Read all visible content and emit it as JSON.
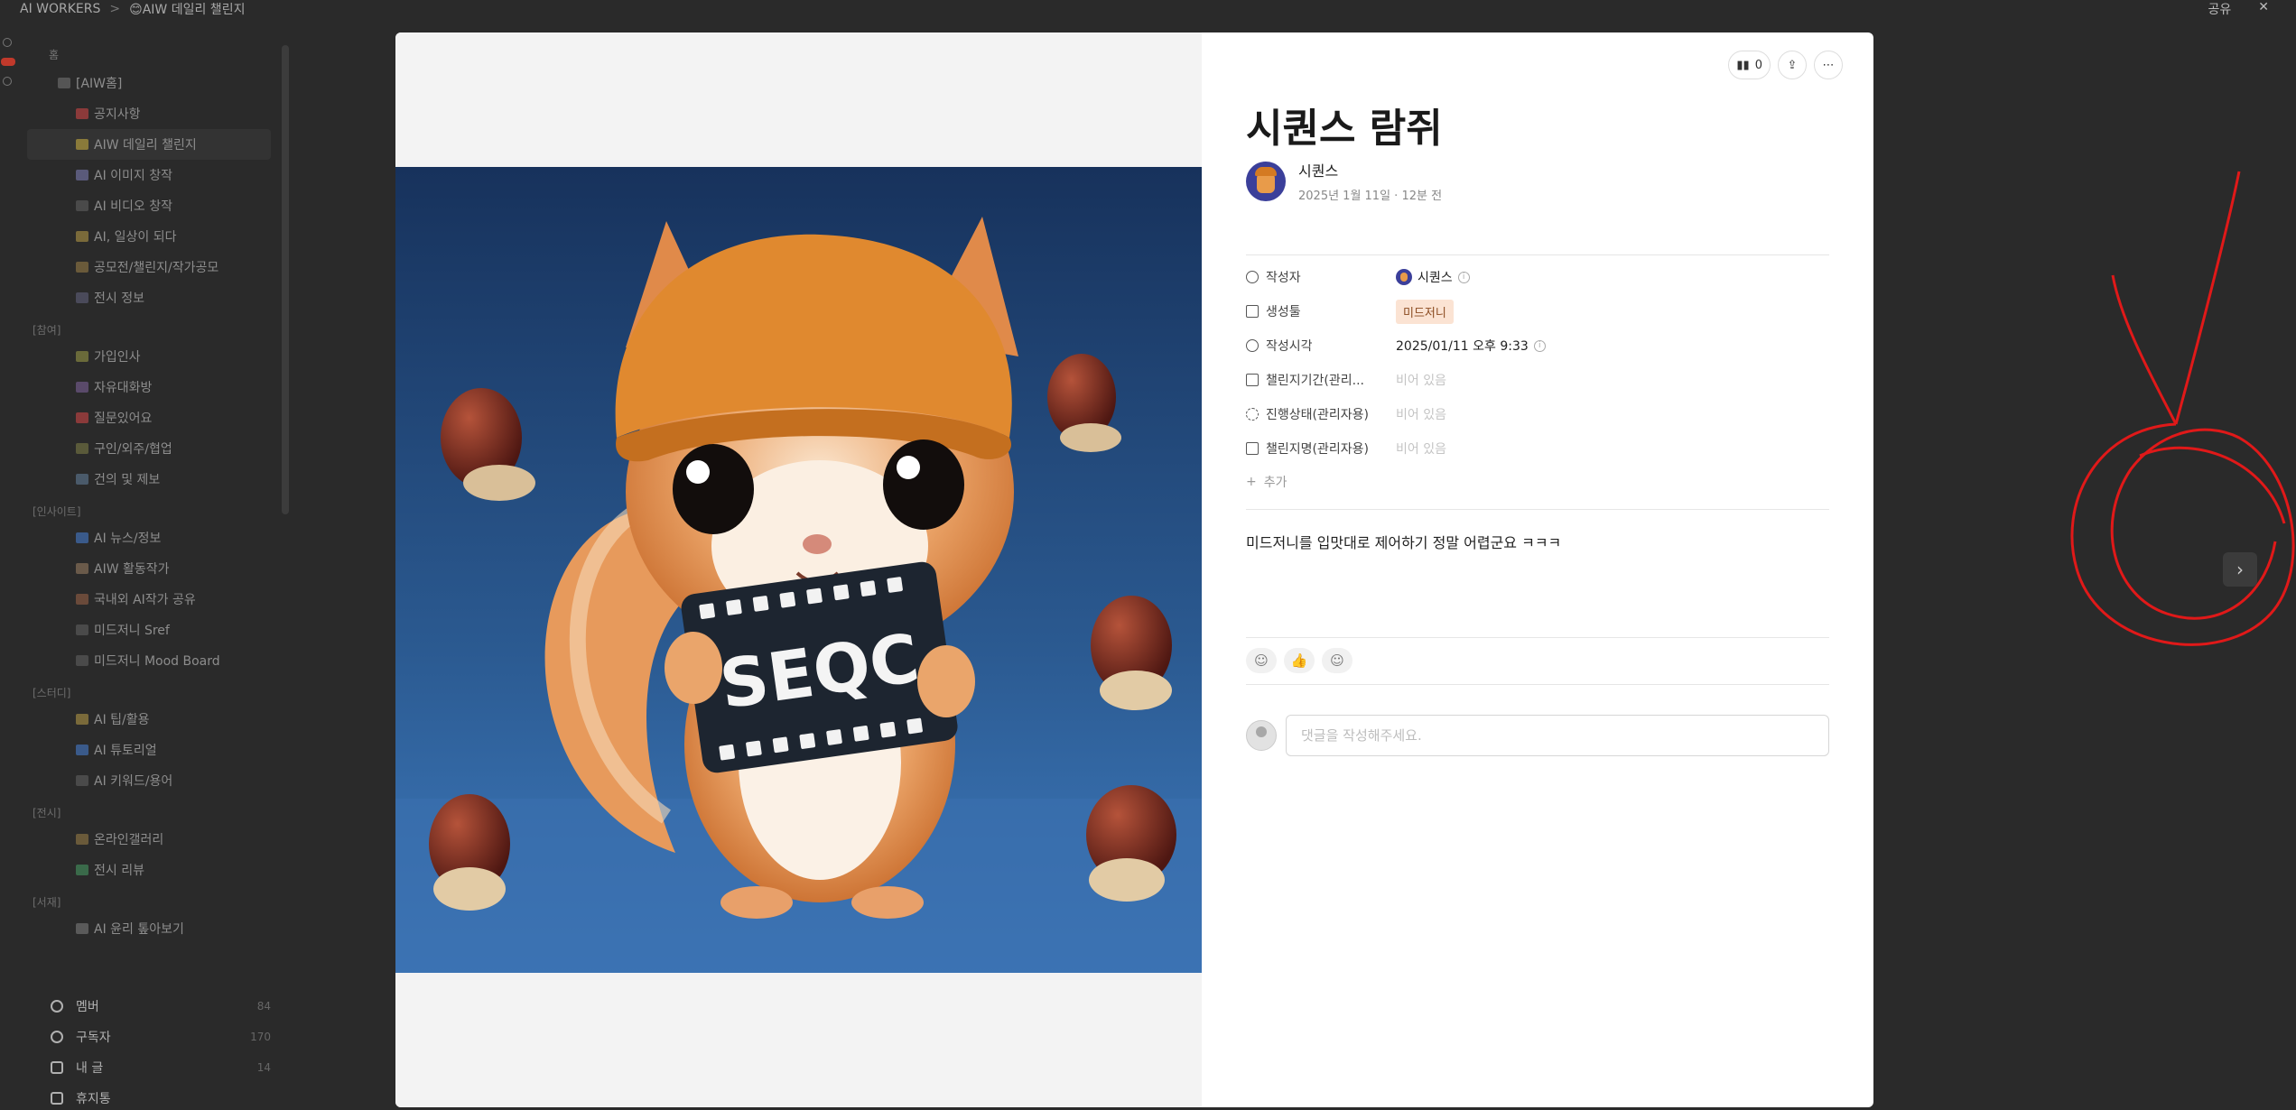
{
  "topbar": {
    "crumb_workspace": "AI WORKERS",
    "crumb_separator": ">",
    "crumb_page": "😊AIW 데일리 챌린지",
    "share_label": "공유",
    "close_glyph": "✕"
  },
  "sidebar": {
    "section_label": "홈",
    "root_label": "[AIW홈]",
    "home_items": [
      {
        "label": "공지사항"
      },
      {
        "label": "AIW 데일리 챌린지"
      },
      {
        "label": "AI 이미지 창작"
      },
      {
        "label": "AI 비디오 창작"
      },
      {
        "label": "AI, 일상이 되다"
      },
      {
        "label": "공모전/챌린지/작가공모"
      },
      {
        "label": "전시 정보"
      }
    ],
    "group1": "[참여]",
    "group1_items": [
      {
        "label": "가입인사"
      },
      {
        "label": "자유대화방"
      },
      {
        "label": "질문있어요"
      },
      {
        "label": "구인/외주/협업"
      },
      {
        "label": "건의 및 제보"
      }
    ],
    "group2": "[인사이트]",
    "group2_items": [
      {
        "label": "AI 뉴스/정보"
      },
      {
        "label": "AIW 활동작가"
      },
      {
        "label": "국내외 AI작가 공유"
      },
      {
        "label": "미드저니 Sref"
      },
      {
        "label": "미드저니 Mood Board"
      }
    ],
    "group3": "[스터디]",
    "group3_items": [
      {
        "label": "AI 팁/활용"
      },
      {
        "label": "AI 튜토리얼"
      },
      {
        "label": "AI 키워드/용어"
      }
    ],
    "group4": "[전시]",
    "group4_items": [
      {
        "label": "온라인갤러리"
      },
      {
        "label": "전시 리뷰"
      }
    ],
    "group5": "[서재]",
    "group5_items": [
      {
        "label": "AI 윤리 톺아보기"
      }
    ],
    "bottom": [
      {
        "label": "멤버",
        "count": "84"
      },
      {
        "label": "구독자",
        "count": "170"
      },
      {
        "label": "내 글",
        "count": "14"
      },
      {
        "label": "휴지통",
        "count": ""
      }
    ]
  },
  "post": {
    "views": "0",
    "title": "시퀀스 람쥐",
    "author": "시퀀스",
    "date": "2025년 1월 11일 · 12분 전",
    "image_caption": "SEQC",
    "props": [
      {
        "key": "작성자",
        "value": "시퀀스",
        "type": "user"
      },
      {
        "key": "생성툴",
        "value": "미드저니",
        "type": "tag"
      },
      {
        "key": "작성시각",
        "value": "2025/01/11 오후 9:33",
        "type": "time"
      },
      {
        "key": "챌린지기간(관리...",
        "value": "비어 있음",
        "type": "empty"
      },
      {
        "key": "진행상태(관리자용)",
        "value": "비어 있음",
        "type": "empty"
      },
      {
        "key": "챌린지명(관리자용)",
        "value": "비어 있음",
        "type": "empty"
      }
    ],
    "add_prop": "추가",
    "body": "미드저니를 입맛대로 제어하기 정말 어렵군요 ㅋㅋㅋ",
    "comment_placeholder": "댓글을 작성해주세요."
  },
  "colors": {
    "annotation": "#e01919",
    "tag_bg": "#fbe3d3",
    "avatar_bg": "#3b3f9a"
  }
}
